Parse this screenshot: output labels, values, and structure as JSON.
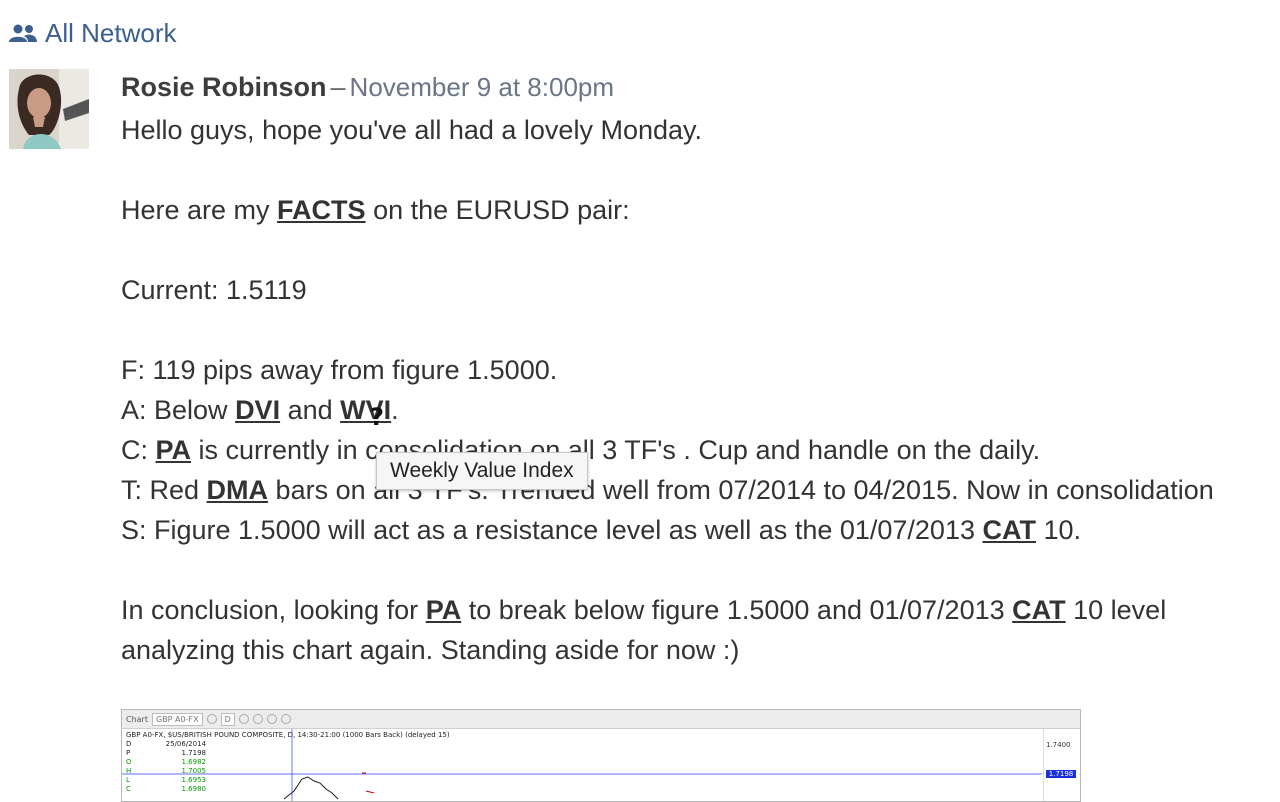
{
  "network": {
    "label": "All Network",
    "icon": "people-icon"
  },
  "post": {
    "author": "Rosie Robinson",
    "separator": "–",
    "timestamp": "November 9 at 8:00pm",
    "lines": {
      "l1": "Hello guys, hope you've all had a lovely Monday.",
      "l2_pre": "Here are my ",
      "l2_term": "FACTS",
      "l2_post": " on the EURUSD pair:",
      "l3": "Current: 1.5119",
      "l4": "F: 119 pips away from figure 1.5000.",
      "l5_pre": "A: Below ",
      "l5_t1": "DVI",
      "l5_mid": " and ",
      "l5_t2": "WVI",
      "l5_post": ".",
      "l6_pre": "C: ",
      "l6_t1": "PA",
      "l6_post": " is currently in consolidation on all 3 TF's . Cup and handle on the daily.",
      "l7_pre": "T: Red ",
      "l7_t1": "DMA",
      "l7_post": " bars on all 3 TF's. Trended well from 07/2014 to 04/2015. Now in consolidation",
      "l8_pre": "S: Figure 1.5000 will act as a resistance level as well as the 01/07/2013 ",
      "l8_t1": "CAT",
      "l8_post": " 10.",
      "l9_pre": "In conclusion, looking for ",
      "l9_t1": "PA",
      "l9_mid": " to break below figure 1.5000 and 01/07/2013 ",
      "l9_t2": "CAT",
      "l9_post": " 10 level",
      "l10": "analyzing this chart again. Standing aside for now :)"
    }
  },
  "tooltip": {
    "text": "Weekly Value Index"
  },
  "chart_image": {
    "tab": "Chart",
    "symbol_box": "GBP A0-FX",
    "interval_box": "D",
    "subtitle": "GBP A0-FX, $US/BRITISH POUND COMPOSITE, D, 14:30-21:00 (1000 Bars Back) (delayed 15)",
    "ohlc": [
      {
        "k": "D",
        "v": "25/06/2014"
      },
      {
        "k": "P",
        "v": "1.7198"
      },
      {
        "k": "O",
        "v": "1.6982"
      },
      {
        "k": "H",
        "v": "1.7005"
      },
      {
        "k": "L",
        "v": "1.6953"
      },
      {
        "k": "C",
        "v": "1.6980"
      }
    ],
    "axis_top": "1.7400",
    "price_tag": "1.7198",
    "colors": {
      "up": "#00a000",
      "down": "#d00000",
      "tag": "#1a2fdd"
    }
  }
}
